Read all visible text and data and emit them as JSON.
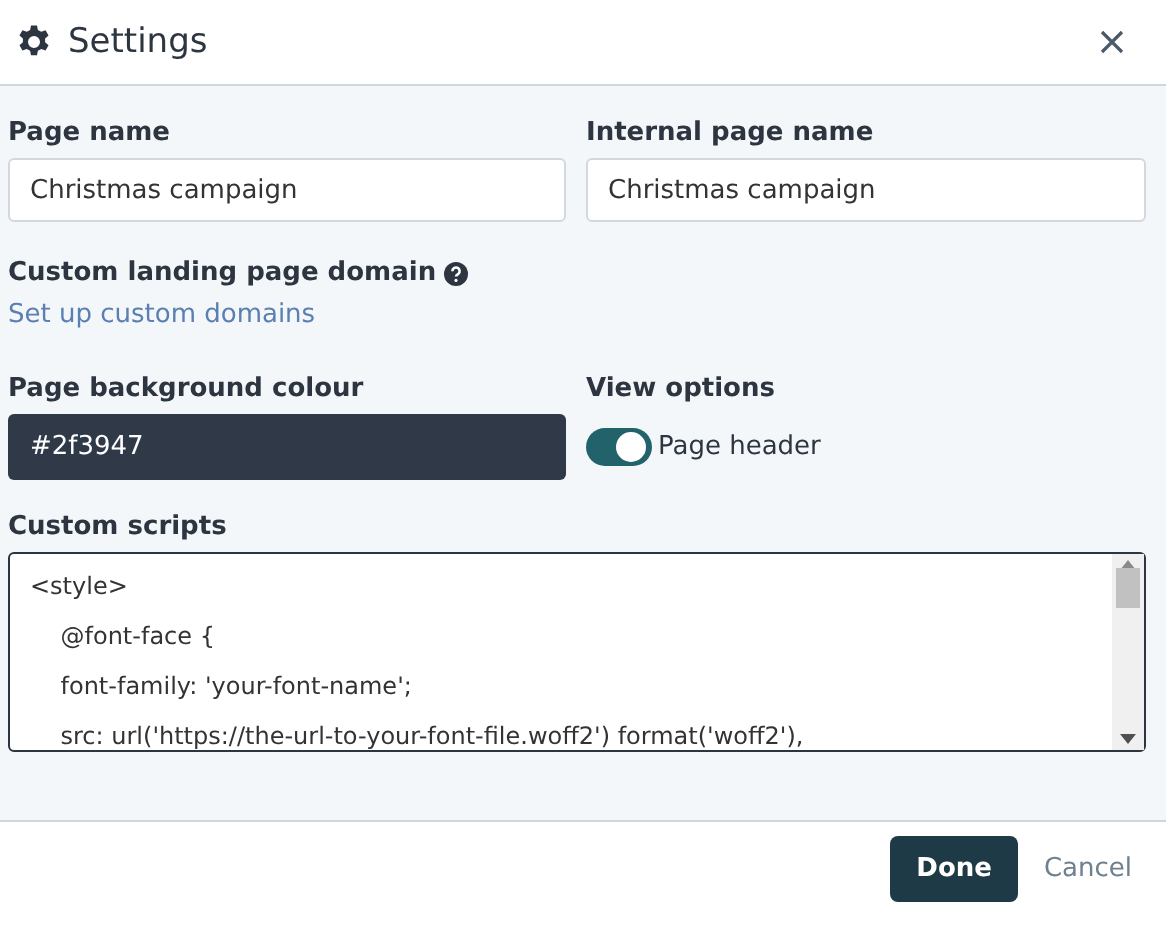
{
  "dialog": {
    "title": "Settings"
  },
  "fields": [
    {
      "label": "Page name",
      "value": "Christmas campaign"
    },
    {
      "label": "Internal page name",
      "value": "Christmas campaign"
    }
  ],
  "domain": {
    "label": "Custom landing page domain",
    "link": "Set up custom domains"
  },
  "background": {
    "label": "Page background colour",
    "value": "#2f3947"
  },
  "view_options": {
    "label": "View options",
    "toggle": {
      "label": "Page header",
      "on": true
    }
  },
  "custom_scripts": {
    "label": "Custom scripts",
    "lines": [
      "<style>",
      "    @font-face {",
      "    font-family: 'your-font-name';",
      "    src: url('https://the-url-to-your-font-file.woff2') format('woff2'),"
    ]
  },
  "buttons": [
    {
      "label": "Done",
      "kind": "primary"
    },
    {
      "label": "Cancel",
      "kind": "link"
    }
  ]
}
